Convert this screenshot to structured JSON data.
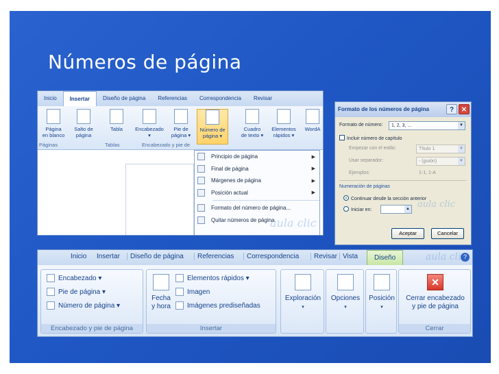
{
  "slide": {
    "title": "Números de página"
  },
  "shot1": {
    "tabs": [
      "Inicio",
      "Insertar",
      "Diseño de página",
      "Referencias",
      "Correspondencia",
      "Revisar"
    ],
    "buttons": [
      {
        "line1": "Página",
        "line2": "en blanco"
      },
      {
        "line1": "Salto de",
        "line2": "página"
      },
      {
        "line1": "Tabla",
        "line2": ""
      },
      {
        "line1": "Encabezado",
        "line2": "▾"
      },
      {
        "line1": "Pie de",
        "line2": "página ▾"
      },
      {
        "line1": "Número de",
        "line2": "página ▾"
      },
      {
        "line1": "Cuadro",
        "line2": "de texto ▾"
      },
      {
        "line1": "Elementos",
        "line2": "rápidos ▾"
      },
      {
        "line1": "WordA",
        "line2": ""
      }
    ],
    "groups": [
      "Páginas",
      "Tablas",
      "Encabezado y pie de"
    ],
    "menu": [
      "Principio de página",
      "Final de página",
      "Márgenes de página",
      "Posición actual",
      "Formato del número de página...",
      "Quitar números de página"
    ],
    "watermark": "aula clic"
  },
  "dialog": {
    "title": "Formato de los números de página",
    "format_label": "Formato de número:",
    "format_value": "1, 2, 3, ...",
    "include_chapter": "Incluir número de capítulo",
    "start_style_label": "Empezar con el estilo:",
    "start_style_value": "Título 1",
    "separator_label": "Usar separador:",
    "separator_value": "-   (guión)",
    "examples_label": "Ejemplos:",
    "examples_value": "1-1, 1-A",
    "numbering_section": "Numeración de páginas",
    "continue_option": "Continuar desde la sección anterior",
    "start_at_option": "Iniciar en:",
    "accept": "Aceptar",
    "cancel": "Cancelar",
    "help": "?",
    "close": "✕"
  },
  "shot2": {
    "tabs": [
      "Inicio",
      "Insertar",
      "Diseño de página",
      "Referencias",
      "Correspondencia",
      "Revisar",
      "Vista",
      "Diseño"
    ],
    "header_group": {
      "items": [
        "Encabezado ▾",
        "Pie de página ▾",
        "Número de página ▾"
      ],
      "label": "Encabezado y pie de página"
    },
    "insert_group": {
      "date_line1": "Fecha",
      "date_line2": "y hora",
      "items": [
        "Elementos rápidos ▾",
        "Imagen",
        "Imágenes prediseñadas"
      ],
      "label": "Insertar"
    },
    "nav": {
      "line1": "Exploración",
      "line2": "▾"
    },
    "options": {
      "line1": "Opciones",
      "line2": "▾"
    },
    "position": {
      "line1": "Posición",
      "line2": "▾"
    },
    "close_group": {
      "line1": "Cerrar encabezado",
      "line2": "y pie de página",
      "label": "Cerrar"
    },
    "watermark": "aula clic"
  }
}
